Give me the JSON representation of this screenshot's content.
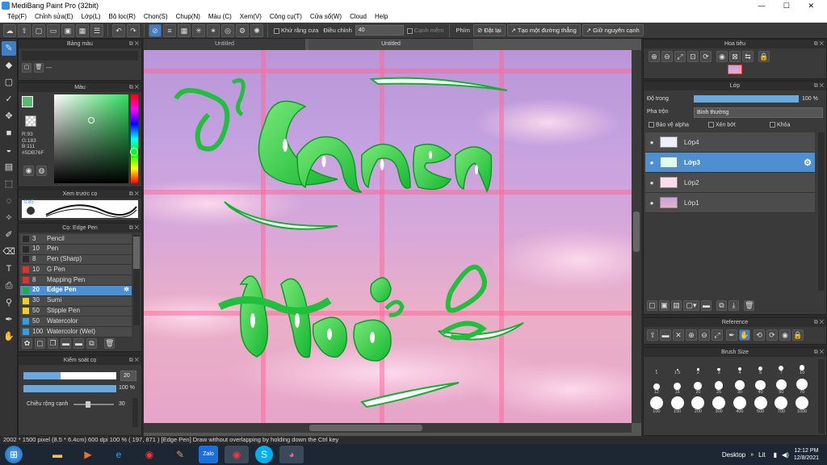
{
  "window": {
    "title": "MediBang Paint Pro (32bit)"
  },
  "menu": [
    "Tệp(F)",
    "Chỉnh sửa(E)",
    "Lớp(L)",
    "Bộ lọc(R)",
    "Chọn(S)",
    "Chụp(N)",
    "Màu (C)",
    "Xem(V)",
    "Công cụ(T)",
    "Cửa sổ(W)",
    "Cloud",
    "Help"
  ],
  "toolbar": {
    "antialias_label": "Khử răng cưa",
    "adjust_label": "Điều chỉnh",
    "adjust_value": "40",
    "snap_label": "Cạnh mềm",
    "key_label": "Phím",
    "reset_label": "Đặt lại",
    "make_line_label": "Tạo một đường thẳng",
    "keep_label": "Giữ nguyên cạnh"
  },
  "tabs": [
    "Untitled",
    "Untitled"
  ],
  "palette_panel": {
    "title": "Bảng màu",
    "dots": "---"
  },
  "color_panel": {
    "title": "Màu",
    "r": "R:93",
    "g": "G:183",
    "b": "B:111",
    "hex": "#5DB76F",
    "fg": "#5DB76F",
    "bg": "#ffffff"
  },
  "brush_preview": {
    "title": "Xem trước cọ",
    "size": "0.85"
  },
  "brush_panel": {
    "title": "Cọ: Edge Pen",
    "items": [
      {
        "size": "3",
        "name": "Pencil",
        "color": "#2a2a2a"
      },
      {
        "size": "10",
        "name": "Pen",
        "color": "#2a2a2a"
      },
      {
        "size": "8",
        "name": "Pen (Sharp)",
        "color": "#2a2a2a"
      },
      {
        "size": "10",
        "name": "G Pen",
        "color": "#e03030"
      },
      {
        "size": "8",
        "name": "Mapping Pen",
        "color": "#e03030"
      },
      {
        "size": "20",
        "name": "Edge Pen",
        "color": "#20b040"
      },
      {
        "size": "30",
        "name": "Sumi",
        "color": "#f0d020"
      },
      {
        "size": "50",
        "name": "Stipple Pen",
        "color": "#f0d020"
      },
      {
        "size": "50",
        "name": "Watercolor",
        "color": "#30a0e0"
      },
      {
        "size": "100",
        "name": "Watercolor (Wet)",
        "color": "#30a0e0"
      }
    ],
    "selected": 5
  },
  "control_panel": {
    "title": "Kiểm soát cọ",
    "size_value": "20",
    "opacity_value": "100 %",
    "edge_label": "Chiều rộng cạnh",
    "edge_value": "30"
  },
  "navigator": {
    "title": "Hoa tiêu"
  },
  "layer_panel": {
    "title": "Lớp",
    "opacity_label": "Độ trong",
    "opacity_value": "100 %",
    "blend_label": "Pha trộn",
    "blend_value": "Bình thường",
    "protect_alpha": "Bảo vệ alpha",
    "clip": "Xén bớt",
    "lock": "Khóa",
    "layers": [
      "Lớp4",
      "Lớp3",
      "Lớp2",
      "Lớp1"
    ],
    "selected": 1
  },
  "reference_panel": {
    "title": "Reference"
  },
  "brush_size_panel": {
    "title": "Brush Size",
    "row1": [
      "1",
      "1.5",
      "2",
      "3",
      "4",
      "5",
      "7",
      "10"
    ],
    "row2": [
      "12",
      "15",
      "20",
      "25",
      "30",
      "40",
      "50",
      "70"
    ],
    "row3": [
      "100",
      "150",
      "200",
      "300",
      "400",
      "500",
      "700",
      "1000"
    ]
  },
  "status": "2002 * 1500 pixel   (8.5 * 6.4cm)   600 dpi   100 %   ( 197, 871 )   [Edge Pen] Draw without overlapping by holding down the Ctrl key",
  "taskbar": {
    "desktop_label": "Desktop",
    "time": "12:12 PM",
    "date": "12/8/2021",
    "lang": "Lit"
  },
  "colors": {
    "accent": "#4d8fd0",
    "green": "#1fc03c"
  }
}
